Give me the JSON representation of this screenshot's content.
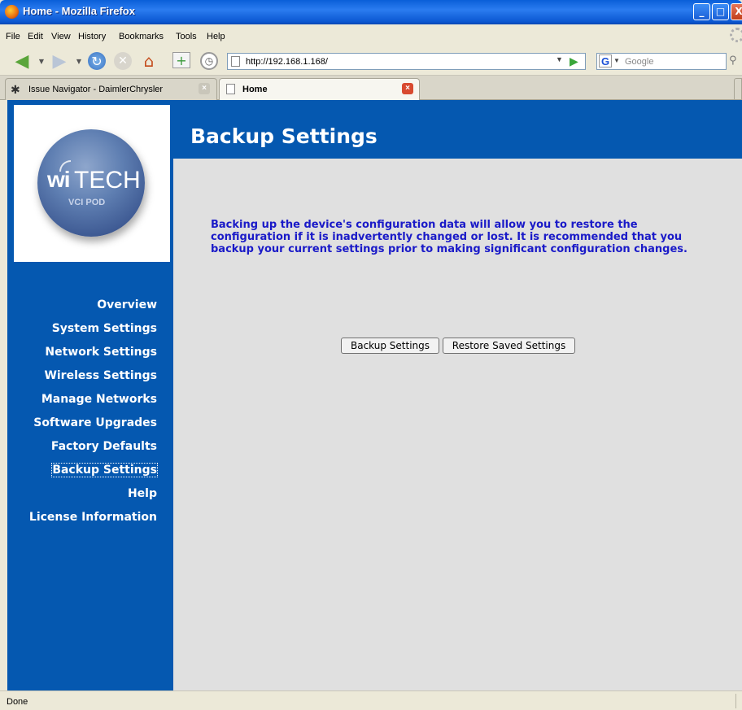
{
  "window": {
    "title": "Home - Mozilla Firefox",
    "buttons": {
      "minimize": "_",
      "maximize": "□",
      "close": "X"
    }
  },
  "menubar": {
    "items": [
      "File",
      "Edit",
      "View",
      "History",
      "Bookmarks",
      "Tools",
      "Help"
    ]
  },
  "navbar": {
    "url": "http://192.168.1.168/",
    "search_placeholder": "Google",
    "icons": [
      "back-arrow-icon",
      "forward-arrow-icon",
      "reload-icon",
      "stop-icon",
      "home-icon",
      "new-tab-icon",
      "history-clock-icon",
      "go-arrow-icon",
      "google-icon",
      "search-magnifier-icon"
    ]
  },
  "tabs": [
    {
      "label": "Issue Navigator - DaimlerChrysler",
      "active": false
    },
    {
      "label": "Home",
      "active": true
    }
  ],
  "page": {
    "logo": {
      "brand": "wiTECH",
      "brand_prefix": "wi",
      "brand_suffix": "TECH",
      "tagline": "VCI POD"
    },
    "heading": "Backup Settings",
    "sidebar_nav": [
      "Overview",
      "System Settings",
      "Network Settings",
      "Wireless Settings",
      "Manage Networks",
      "Software Upgrades",
      "Factory Defaults",
      "Backup Settings",
      "Help",
      "License Information"
    ],
    "active_nav": "Backup Settings",
    "description": "Backing up the device's configuration data will allow you to restore the configuration if it is inadvertently changed or lost.  It is recommended that you backup your current settings prior to making significant configuration changes.",
    "buttons": {
      "backup": "Backup Settings",
      "restore": "Restore Saved Settings"
    },
    "colors": {
      "brand_blue": "#0558b0",
      "text_blue": "#1a1ac8",
      "panel_gray": "#e0e0e0"
    }
  },
  "statusbar": {
    "text": "Done"
  }
}
